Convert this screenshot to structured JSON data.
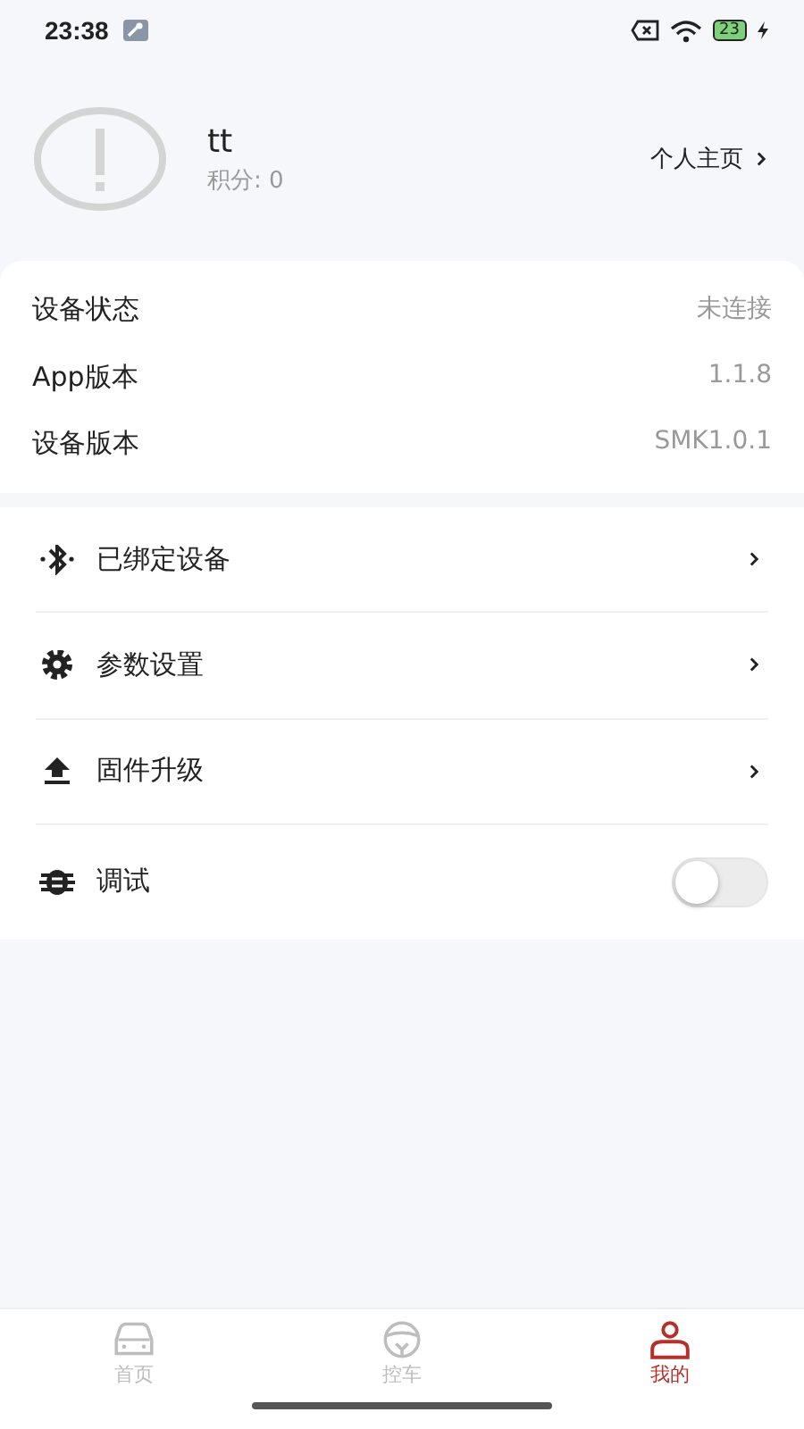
{
  "status_bar": {
    "time": "23:38",
    "battery": "23"
  },
  "profile": {
    "name": "tt",
    "points": "积分: 0",
    "link": "个人主页"
  },
  "info": [
    {
      "label": "设备状态",
      "value": "未连接"
    },
    {
      "label": "App版本",
      "value": "1.1.8"
    },
    {
      "label": "设备版本",
      "value": "SMK1.0.1"
    }
  ],
  "menu": [
    {
      "kind": "link",
      "label": "已绑定设备"
    },
    {
      "kind": "link",
      "label": "参数设置"
    },
    {
      "kind": "link",
      "label": "固件升级"
    },
    {
      "kind": "toggle",
      "label": "调试",
      "on": false
    }
  ],
  "tabs": [
    {
      "label": "首页",
      "selected": false
    },
    {
      "label": "控车",
      "selected": false
    },
    {
      "label": "我的",
      "selected": true
    }
  ]
}
